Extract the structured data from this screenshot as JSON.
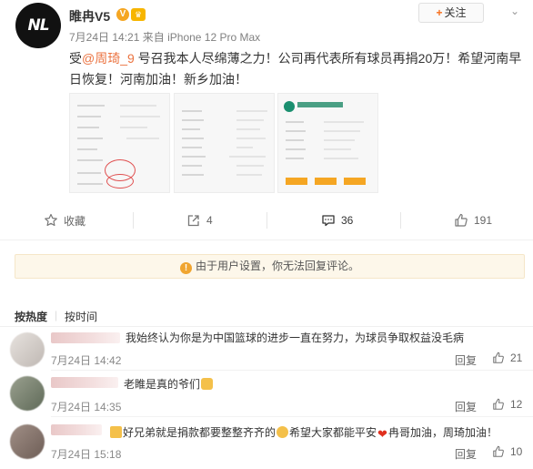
{
  "post": {
    "author": "睢冉V5",
    "avatar_text": "NL",
    "time": "7月24日 14:21",
    "source_prefix": "来自",
    "source": "iPhone 12 Pro Max",
    "follow_label": "关注",
    "text_before_mention": "受",
    "mention": "@周琦_9",
    "text_after_mention": " 号召我本人尽绵薄之力！公司再代表所有球员再捐20万！希望河南早日恢复！河南加油！新乡加油！",
    "images": [
      "donation-receipt-1",
      "donation-receipt-2",
      "bank-transfer-screenshot"
    ]
  },
  "actions": {
    "favorite_label": "收藏",
    "forward_count": "4",
    "comment_count": "36",
    "like_count": "191"
  },
  "notice": {
    "text": "由于用户设置，你无法回复评论。"
  },
  "sort": {
    "hot_label": "按热度",
    "time_label": "按时间"
  },
  "comments": [
    {
      "text": "我始终认为你是为中国篮球的进步一直在努力，为球员争取权益没毛病",
      "time": "7月24日 14:42",
      "reply_label": "回复",
      "likes": "21"
    },
    {
      "text": "老睢是真的爷们",
      "time": "7月24日 14:35",
      "reply_label": "回复",
      "likes": "12"
    },
    {
      "text_part1": "好兄弟就是捐款都要整整齐齐的",
      "text_part2": "希望大家都能平安",
      "text_part3": "冉哥加油，周琦加油！",
      "time": "7月24日 15:18",
      "reply_label": "回复",
      "likes": "10"
    }
  ],
  "colors": {
    "mention": "#eb7340",
    "notice_bg": "#fdf7ea",
    "warn": "#f0a530"
  }
}
